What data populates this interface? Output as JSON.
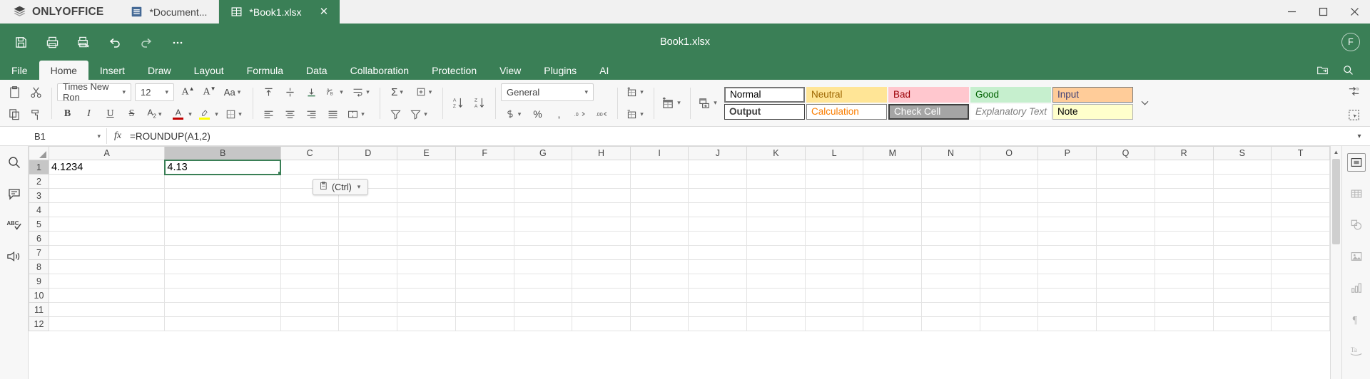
{
  "titlebar": {
    "brand": "ONLYOFFICE",
    "tabs": [
      {
        "label": "*Document...",
        "icon": "document-icon",
        "active": false
      },
      {
        "label": "*Book1.xlsx",
        "icon": "spreadsheet-icon",
        "active": true,
        "close": "✕"
      }
    ],
    "window_controls": {
      "minimize": "─",
      "maximize": "☐",
      "close": "✕"
    }
  },
  "header": {
    "doc_title": "Book1.xlsx",
    "user_initial": "F",
    "quick_access": [
      "save-icon",
      "print-icon",
      "quick-print-icon",
      "undo-icon",
      "redo-icon",
      "more-icon"
    ]
  },
  "menu": {
    "items": [
      {
        "label": "File",
        "active": false
      },
      {
        "label": "Home",
        "active": true
      },
      {
        "label": "Insert",
        "active": false
      },
      {
        "label": "Draw",
        "active": false
      },
      {
        "label": "Layout",
        "active": false
      },
      {
        "label": "Formula",
        "active": false
      },
      {
        "label": "Data",
        "active": false
      },
      {
        "label": "Collaboration",
        "active": false
      },
      {
        "label": "Protection",
        "active": false
      },
      {
        "label": "View",
        "active": false
      },
      {
        "label": "Plugins",
        "active": false
      },
      {
        "label": "AI",
        "active": false
      }
    ],
    "right_icons": [
      "open-file-location-icon",
      "search-icon"
    ]
  },
  "ribbon": {
    "clipboard": [
      "paste-icon",
      "cut-icon",
      "copy-icon",
      "format-painter-icon"
    ],
    "font_name": "Times New Ron",
    "font_size": "12",
    "increase_font_icon": "increase-font-size-icon",
    "decrease_font_icon": "decrease-font-size-icon",
    "change_case_icon": "change-case-icon",
    "font_buttons": [
      "bold",
      "italic",
      "underline",
      "strikethrough",
      "subscript-superscript",
      "font-color",
      "highlight-color",
      "borders"
    ],
    "alignment_top": [
      "align-top-icon",
      "align-middle-icon",
      "align-bottom-icon",
      "orientation-icon",
      "wrap-text-icon"
    ],
    "alignment_bottom": [
      "align-left-icon",
      "align-center-icon",
      "align-right-icon",
      "justify-icon",
      "merge-cells-icon"
    ],
    "functions": [
      "autosum-icon",
      "insert-function-icon"
    ],
    "sort_asc_icon": "sort-ascending-icon",
    "sort_desc_icon": "sort-descending-icon",
    "filter_icon": "filter-icon",
    "number_format": "General",
    "number_buttons": [
      "accounting-format-icon",
      "percent-style-icon",
      "comma-style-icon",
      "decrease-decimal-icon",
      "increase-decimal-icon"
    ],
    "insert_cells_icon": "insert-cells-icon",
    "delete_cells_icon": "delete-cells-icon",
    "format_as_table_icon": "format-as-table-icon",
    "conditional_formatting_icon": "conditional-formatting-icon",
    "right_buttons": [
      "replace-icon",
      "select-all-icon"
    ],
    "styles": [
      [
        {
          "label": "Normal",
          "bg": "#ffffff",
          "fg": "#000000",
          "border": "#777777",
          "italic": false
        },
        {
          "label": "Neutral",
          "bg": "#ffe596",
          "fg": "#9c6500",
          "border": "#ffe596",
          "italic": false
        },
        {
          "label": "Bad",
          "bg": "#ffc7ce",
          "fg": "#9c0006",
          "border": "#ffc7ce",
          "italic": false
        },
        {
          "label": "Good",
          "bg": "#c6efce",
          "fg": "#006100",
          "border": "#c6efce",
          "italic": false
        },
        {
          "label": "Input",
          "bg": "#ffcc99",
          "fg": "#3f3f76",
          "border": "#7f7f7f",
          "italic": false
        }
      ],
      [
        {
          "label": "Output",
          "bg": "#ffffff",
          "fg": "#3f3f3f",
          "border": "#3f3f3f",
          "italic": false
        },
        {
          "label": "Calculation",
          "bg": "#ffffff",
          "fg": "#fa7d00",
          "border": "#7f7f7f",
          "italic": false
        },
        {
          "label": "Check Cell",
          "bg": "#a5a5a5",
          "fg": "#ffffff",
          "border": "#3f3f3f",
          "italic": false
        },
        {
          "label": "Explanatory Text",
          "bg": "#ffffff",
          "fg": "#7f7f7f",
          "border": "#ffffff",
          "italic": true
        },
        {
          "label": "Note",
          "bg": "#ffffcc",
          "fg": "#000000",
          "border": "#b2b2b2",
          "italic": false
        }
      ]
    ],
    "gallery_more_icon": "chevron-down-icon"
  },
  "formula_bar": {
    "name_box": "B1",
    "fx_symbol": "fx",
    "formula": "=ROUNDUP(A1,2)",
    "expand_icon": "chevron-down-icon"
  },
  "left_sidebar": {
    "icons": [
      "search-icon",
      "comments-icon",
      "spell-check-icon",
      "text-to-speech-icon"
    ]
  },
  "right_sidebar": {
    "icons": [
      "cell-settings-icon",
      "table-settings-icon",
      "shape-settings-icon",
      "image-settings-icon",
      "chart-settings-icon",
      "paragraph-settings-icon",
      "text-art-settings-icon"
    ]
  },
  "grid": {
    "columns": [
      "A",
      "B",
      "C",
      "D",
      "E",
      "F",
      "G",
      "H",
      "I",
      "J",
      "K",
      "L",
      "M",
      "N",
      "O",
      "P",
      "Q",
      "R",
      "S",
      "T"
    ],
    "rows": [
      "1",
      "2",
      "3",
      "4",
      "5",
      "6",
      "7",
      "8",
      "9",
      "10",
      "11",
      "12"
    ],
    "selected_column": "B",
    "selected_row": "1",
    "cells": {
      "A1": "4.1234",
      "B1": "4.13"
    },
    "paste_options": {
      "label": "(Ctrl)",
      "icon": "clipboard-icon",
      "chevron": "⌄"
    }
  },
  "colors": {
    "brand_green": "#3a7f56",
    "ribbon_bg": "#f7f7f7",
    "selection_green": "#3a7f56"
  }
}
